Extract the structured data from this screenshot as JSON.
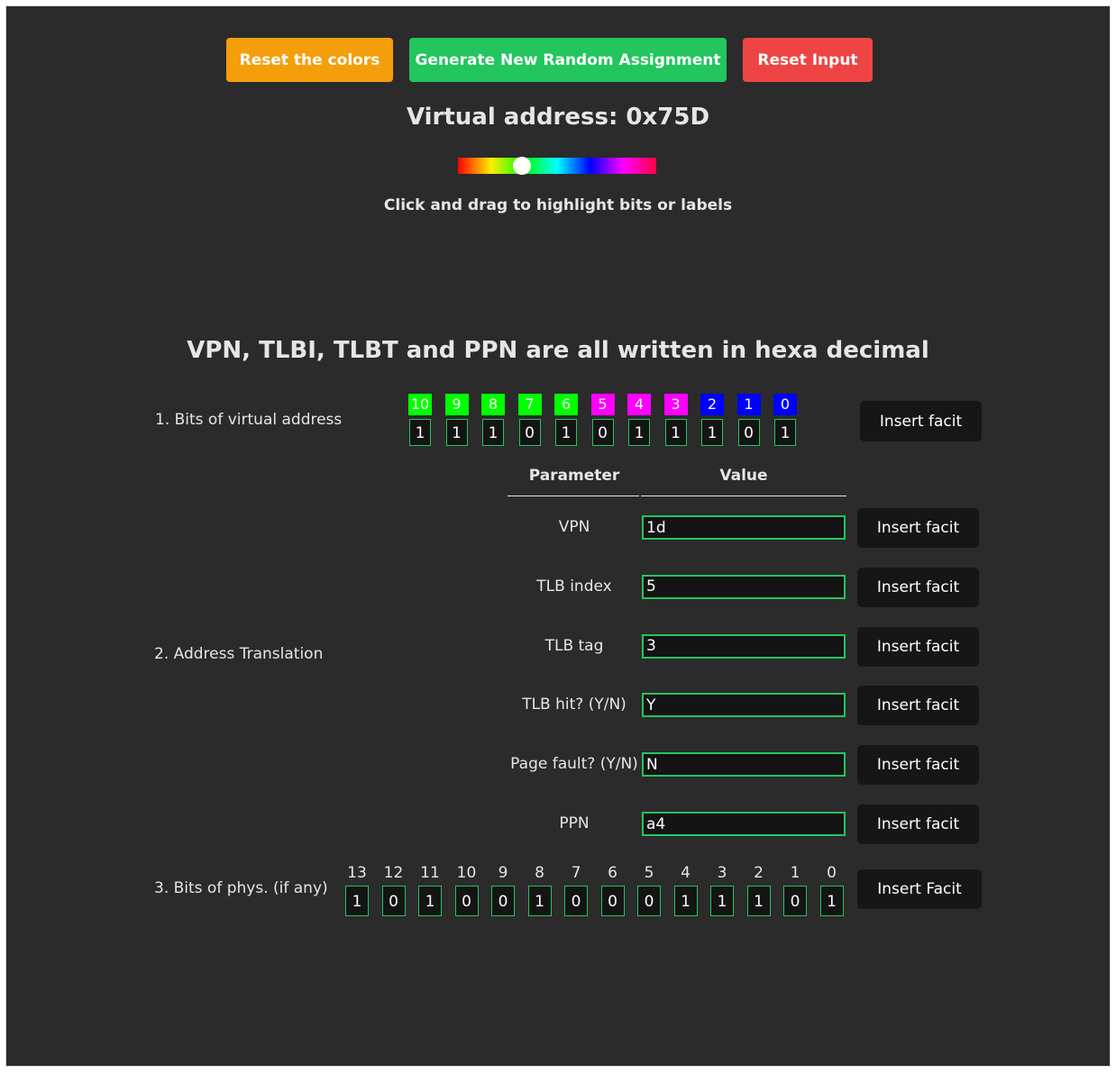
{
  "buttons": {
    "reset_colors": "Reset the colors",
    "generate": "Generate New Random Assignment",
    "reset_input": "Reset Input"
  },
  "title": "Virtual address: 0x75D",
  "hint": "Click and drag to highlight bits or labels",
  "subtitle": "VPN, TLBI, TLBT and PPN are all written in hexa decimal",
  "section1": {
    "label": "1. Bits of virtual address",
    "bits": [
      {
        "label": "10",
        "value": "1",
        "color": "#00ff00"
      },
      {
        "label": "9",
        "value": "1",
        "color": "#00ff00"
      },
      {
        "label": "8",
        "value": "1",
        "color": "#00ff00"
      },
      {
        "label": "7",
        "value": "0",
        "color": "#00ff00"
      },
      {
        "label": "6",
        "value": "1",
        "color": "#00ff00"
      },
      {
        "label": "5",
        "value": "0",
        "color": "#ff00ff"
      },
      {
        "label": "4",
        "value": "1",
        "color": "#ff00ff"
      },
      {
        "label": "3",
        "value": "1",
        "color": "#ff00ff"
      },
      {
        "label": "2",
        "value": "1",
        "color": "#0000ff"
      },
      {
        "label": "1",
        "value": "0",
        "color": "#0000ff"
      },
      {
        "label": "0",
        "value": "1",
        "color": "#0000ff"
      }
    ],
    "insert": "Insert facit"
  },
  "table": {
    "col_param": "Parameter",
    "col_value": "Value"
  },
  "section2": {
    "label": "2. Address Translation",
    "rows": [
      {
        "param": "VPN",
        "value": "1d",
        "insert": "Insert facit"
      },
      {
        "param": "TLB index",
        "value": "5",
        "insert": "Insert facit"
      },
      {
        "param": "TLB tag",
        "value": "3",
        "insert": "Insert facit"
      },
      {
        "param": "TLB hit? (Y/N)",
        "value": "Y",
        "insert": "Insert facit"
      },
      {
        "param": "Page fault? (Y/N)",
        "value": "N",
        "insert": "Insert facit"
      },
      {
        "param": "PPN",
        "value": "a4",
        "insert": "Insert facit"
      }
    ]
  },
  "section3": {
    "label": "3. Bits of phys. (if any)",
    "bits": [
      {
        "label": "13",
        "value": "1"
      },
      {
        "label": "12",
        "value": "0"
      },
      {
        "label": "11",
        "value": "1"
      },
      {
        "label": "10",
        "value": "0"
      },
      {
        "label": "9",
        "value": "0"
      },
      {
        "label": "8",
        "value": "1"
      },
      {
        "label": "7",
        "value": "0"
      },
      {
        "label": "6",
        "value": "0"
      },
      {
        "label": "5",
        "value": "0"
      },
      {
        "label": "4",
        "value": "1"
      },
      {
        "label": "3",
        "value": "1"
      },
      {
        "label": "2",
        "value": "1"
      },
      {
        "label": "1",
        "value": "0"
      },
      {
        "label": "0",
        "value": "1"
      }
    ],
    "insert": "Insert Facit"
  },
  "colors": {
    "reset_colors": "#f59e0b",
    "generate": "#22c55e",
    "reset_input": "#ef4444"
  }
}
